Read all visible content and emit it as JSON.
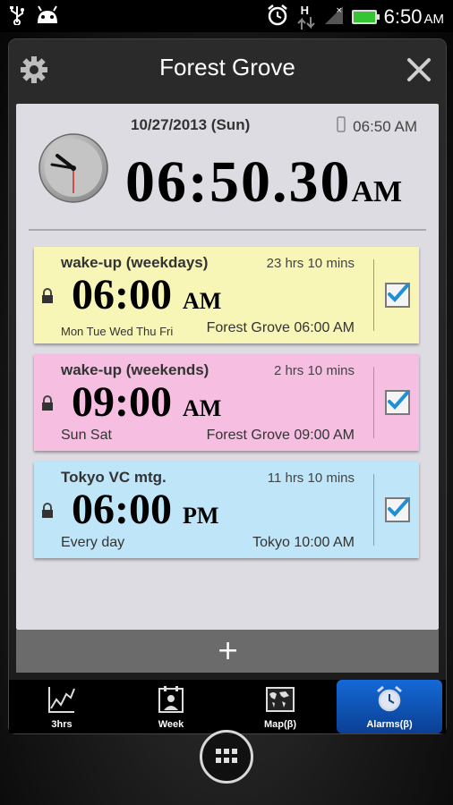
{
  "status_bar": {
    "time": "6:50",
    "ampm": "AM",
    "network": "H",
    "icons": [
      "usb-icon",
      "android-icon",
      "alarm-clock-icon",
      "data-arrows-icon",
      "signal-icon",
      "battery-icon"
    ]
  },
  "widget": {
    "title": "Forest Grove",
    "date": "10/27/2013 (Sun)",
    "phone_time": "06:50 AM",
    "current_time": "06:50.30",
    "current_ampm": "AM"
  },
  "alarms": [
    {
      "name": "wake-up (weekdays)",
      "remaining": "23 hrs 10 mins",
      "time": "06:00",
      "ampm": "AM",
      "days": "Mon Tue Wed Thu Fri",
      "local": "Forest Grove 06:00 AM",
      "color": "#f8f6b6",
      "checked": true
    },
    {
      "name": "wake-up (weekends)",
      "remaining": "2 hrs 10 mins",
      "time": "09:00",
      "ampm": "AM",
      "days": "Sun Sat",
      "local": "Forest Grove 09:00 AM",
      "color": "#f6bfe2",
      "checked": true
    },
    {
      "name": "Tokyo VC mtg.",
      "remaining": "11 hrs 10 mins",
      "time": "06:00",
      "ampm": "PM",
      "days": "Every day",
      "local": "Tokyo 10:00 AM",
      "color": "#bfe6f8",
      "checked": true
    }
  ],
  "add_button": "+",
  "tabs": [
    {
      "label": "3hrs"
    },
    {
      "label": "Week"
    },
    {
      "label": "Map(β)"
    },
    {
      "label": "Alarms(β)",
      "active": true
    }
  ],
  "colors": {
    "accent_tab": "#1469d6",
    "checkmark": "#1f8fd8"
  }
}
